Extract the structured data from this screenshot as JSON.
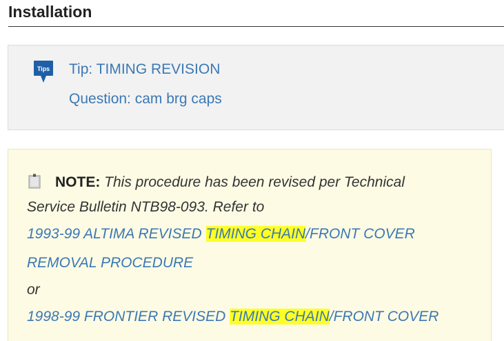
{
  "section": {
    "title": "Installation"
  },
  "tips": {
    "icon_label": "Tips",
    "links": [
      {
        "label": "Tip: TIMING REVISION"
      },
      {
        "label": "Question: cam brg caps"
      }
    ]
  },
  "note": {
    "label": "NOTE:",
    "text_line1": "This procedure has been revised per Technical",
    "text_line2": "Service Bulletin NTB98-093. Refer to",
    "link1": {
      "part1": "1993-99 ALTIMA REVISED ",
      "highlight": "TIMING CHAIN",
      "part2": "/FRONT COVER",
      "line2": "REMOVAL PROCEDURE"
    },
    "or_text": "or",
    "link2": {
      "part1": "1998-99 FRONTIER REVISED ",
      "highlight": "TIMING CHAIN",
      "part2": "/FRONT COVER"
    }
  },
  "colors": {
    "link": "#3b78b5",
    "highlight": "#ffff26",
    "note_bg": "#fdfbe4",
    "tips_bg": "#f2f2f2",
    "tips_icon": "#1f5fa8"
  },
  "icons": {
    "tips": "tips-speech-bubble-icon",
    "note": "clipboard-note-icon"
  }
}
